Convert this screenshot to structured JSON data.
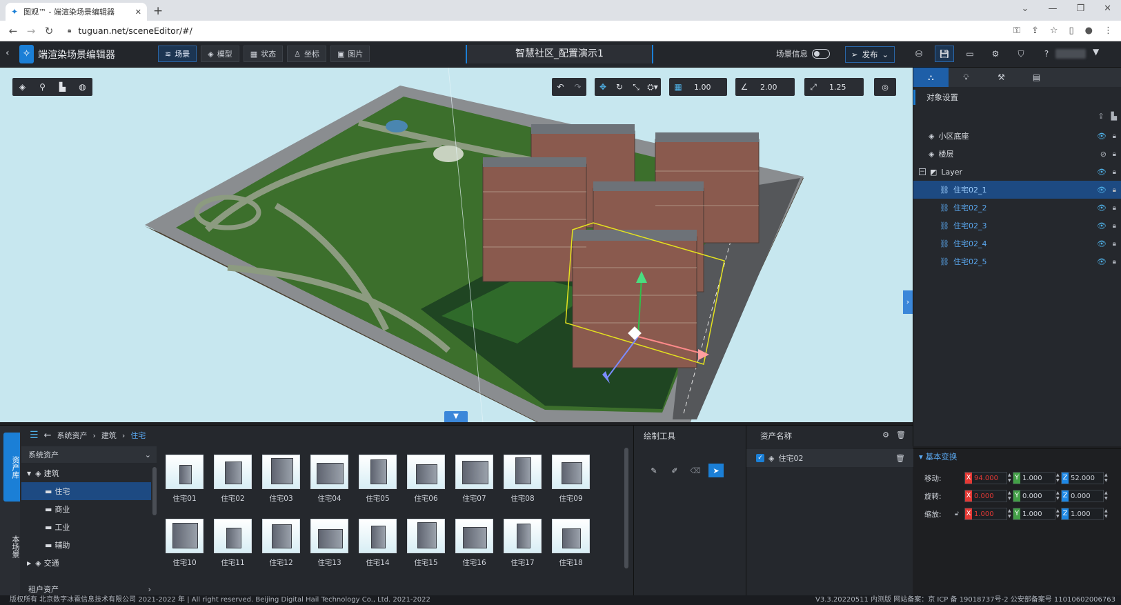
{
  "browser": {
    "tab_title": "图观™ - 端渲染场景编辑器",
    "new_tab": "+",
    "url": "tuguan.net/sceneEditor/#/",
    "win_min": "—",
    "win_restore": "❐",
    "win_close": "✕",
    "win_dropdown": "⌄"
  },
  "app": {
    "title": "端渲染场景编辑器",
    "tabs": [
      {
        "label": "场景"
      },
      {
        "label": "模型"
      },
      {
        "label": "状态"
      },
      {
        "label": "坐标"
      },
      {
        "label": "图片"
      }
    ],
    "scene_name": "智慧社区_配置演示1",
    "scene_info_label": "场景信息",
    "publish_label": "发布"
  },
  "viewport": {
    "grid_snap": "1.00",
    "angle_snap": "2.00",
    "scale_snap": "1.25"
  },
  "right_panel": {
    "title": "对象设置",
    "tree": [
      {
        "label": "小区底座",
        "type": "model"
      },
      {
        "label": "楼层",
        "type": "model"
      },
      {
        "label": "Layer",
        "type": "layer"
      },
      {
        "label": "住宅02_1",
        "type": "child"
      },
      {
        "label": "住宅02_2",
        "type": "child"
      },
      {
        "label": "住宅02_3",
        "type": "child"
      },
      {
        "label": "住宅02_4",
        "type": "child"
      },
      {
        "label": "住宅02_5",
        "type": "child"
      }
    ],
    "basic_transform": "基本变换",
    "move_label": "移动:",
    "rotate_label": "旋转:",
    "scale_label": "缩放:",
    "move": {
      "x": "94.000",
      "y": "1.000",
      "z": "52.000"
    },
    "rotate": {
      "x": "0.000",
      "y": "0.000",
      "z": "0.000"
    },
    "scale": {
      "x": "1.000",
      "y": "1.000",
      "z": "1.000"
    },
    "colors": {
      "x": "#e53935",
      "y": "#43a047",
      "z": "#1e88e5"
    }
  },
  "asset_lib": {
    "side_tab_assets": "资产库",
    "side_tab_scene": "本场景",
    "breadcrumb": [
      "系统资产",
      "建筑",
      "住宅"
    ],
    "source_select": "系统资产",
    "tree": [
      {
        "label": "建筑",
        "level": 0
      },
      {
        "label": "住宅",
        "level": 1
      },
      {
        "label": "商业",
        "level": 1
      },
      {
        "label": "工业",
        "level": 1
      },
      {
        "label": "辅助",
        "level": 1
      },
      {
        "label": "交通",
        "level": 0
      }
    ],
    "tenant_label": "租户资产",
    "items": [
      "住宅01",
      "住宅02",
      "住宅03",
      "住宅04",
      "住宅05",
      "住宅06",
      "住宅07",
      "住宅08",
      "住宅09",
      "住宅10",
      "住宅11",
      "住宅12",
      "住宅13",
      "住宅14",
      "住宅15",
      "住宅16",
      "住宅17",
      "住宅18"
    ]
  },
  "draw_tools": {
    "title": "绘制工具"
  },
  "asset_names": {
    "title": "资产名称",
    "entry": "住宅02"
  },
  "footer": {
    "left": "版权所有 北京数字冰雹信息技术有限公司 2021-2022 年 | All right reserved. Beijing Digital Hail Technology Co., Ltd. 2021-2022",
    "right": "V3.3.20220511 内测版 网站备案：京 ICP 备 19018737号-2 公安部备案号 11010602006763"
  }
}
